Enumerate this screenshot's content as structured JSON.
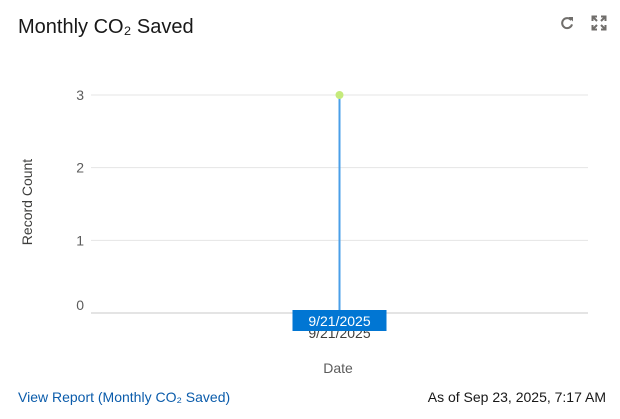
{
  "title": "Monthly CO₂ Saved",
  "actions": {
    "refresh_icon": "refresh-icon",
    "expand_icon": "expand-icon"
  },
  "chart_data": {
    "type": "line",
    "x": [
      "9/21/2025"
    ],
    "series": [
      {
        "values": [
          3
        ]
      }
    ],
    "xlabel": "Date",
    "ylabel": "Record Count",
    "ylim": [
      0,
      3
    ],
    "yticks": [
      0,
      1,
      2,
      3
    ],
    "grid": true,
    "highlight_label": "9/21/2025",
    "colors": {
      "line": "#4a9fe8",
      "point": "#c5ea7c",
      "highlight_bg": "#0176d3",
      "grid": "#e5e5e5",
      "tick": "#5c5c5c"
    }
  },
  "footer": {
    "link": "View Report (Monthly CO₂ Saved)",
    "timestamp": "As of Sep 23, 2025, 7:17 AM"
  }
}
